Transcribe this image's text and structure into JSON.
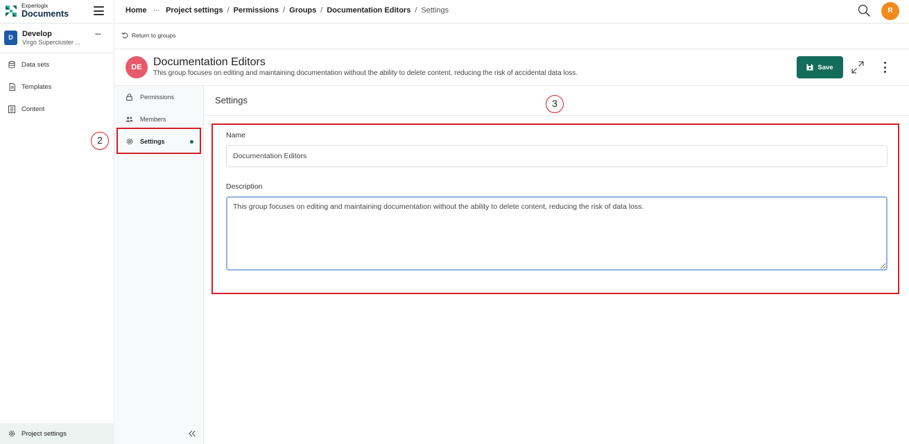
{
  "app": {
    "logo_small": "Experlogix",
    "logo_big": "Documents",
    "brand_color": "#146c5a"
  },
  "project": {
    "avatar": "D",
    "name": "Develop",
    "subtitle": "Virgo Supercluster ...",
    "more_label": "···"
  },
  "sidebar": {
    "items": [
      {
        "label": "Data sets",
        "icon": "database-icon"
      },
      {
        "label": "Templates",
        "icon": "document-icon"
      },
      {
        "label": "Content",
        "icon": "content-icon"
      }
    ],
    "bottom_item": {
      "label": "Project settings",
      "icon": "gear-icon"
    }
  },
  "breadcrumb": {
    "home": "Home",
    "ellipsis": "···",
    "items": [
      "Project settings",
      "Permissions",
      "Groups",
      "Documentation Editors"
    ],
    "current": "Settings",
    "separator": "/"
  },
  "user": {
    "avatar": "R"
  },
  "return_link": "Return to groups",
  "group": {
    "avatar": "DE",
    "title": "Documentation Editors",
    "description": "This group focuses on editing and maintaining documentation without the ability to delete content, reducing the risk of accidental data loss."
  },
  "toolbar": {
    "save_label": "Save"
  },
  "tabs": [
    {
      "label": "Permissions",
      "icon": "lock-icon"
    },
    {
      "label": "Members",
      "icon": "users-icon"
    },
    {
      "label": "Settings",
      "icon": "gear-icon",
      "active": true
    }
  ],
  "settings": {
    "heading": "Settings",
    "name_label": "Name",
    "name_value": "Documentation Editors",
    "description_label": "Description",
    "description_value": "This group focuses on editing and maintaining documentation without the ability to delete content, reducing the risk of data loss."
  },
  "annotations": {
    "marker_2": "2",
    "marker_3": "3"
  }
}
